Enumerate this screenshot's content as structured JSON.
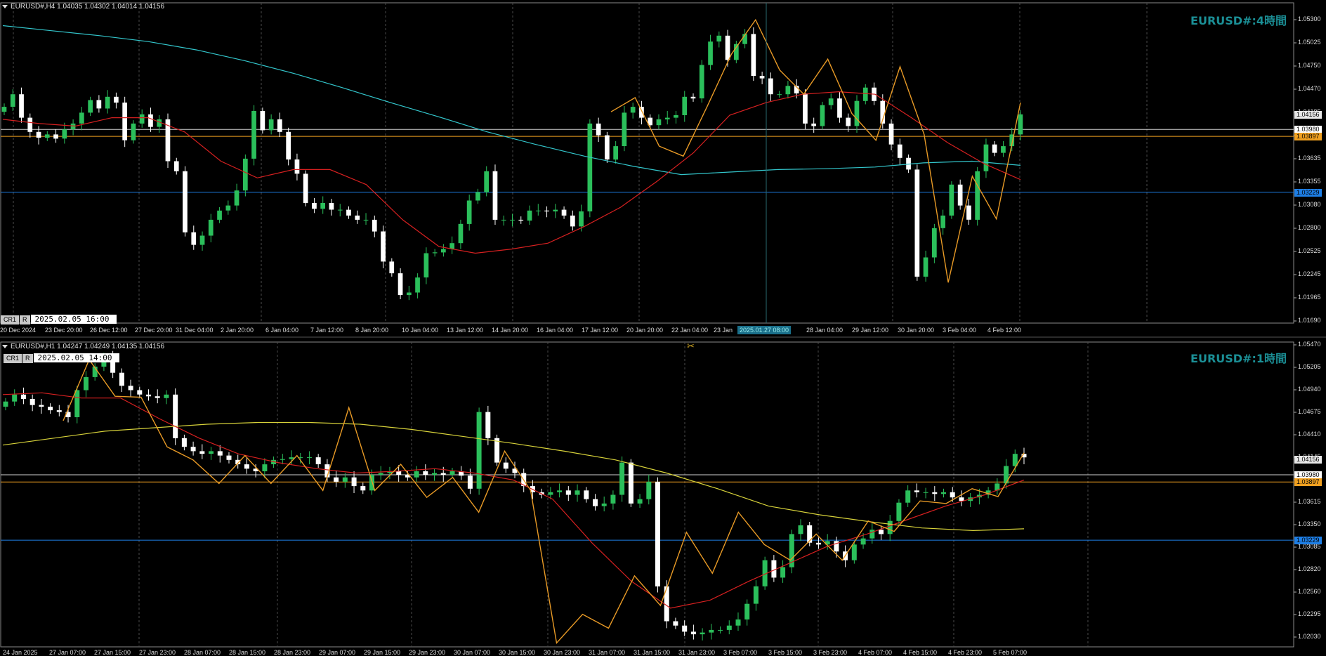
{
  "colors": {
    "bull": "#2bbf5b",
    "bear": "#ffffff",
    "ma_red": "#d62020",
    "ma_cyan": "#33c6cc",
    "ma_yellow": "#d7d23a",
    "zigzag": "#e89a26",
    "line_white": "#cfcfcf",
    "line_orange": "#f0a020",
    "line_blue": "#1e7fe6",
    "grid": "#4a4a4a",
    "watermark": "#1b8f96"
  },
  "h4": {
    "header": "EURUSD#,H4  1.04035 1.04302 1.04014 1.04156",
    "watermark": "EURUSD#:4時間",
    "cr": "CR1",
    "r": "R",
    "datetime": "2025.02.05 16:00",
    "price_ticks": [
      "1.05300",
      "1.05025",
      "1.04750",
      "1.04470",
      "1.04195",
      "1.03915",
      "1.03635",
      "1.03355",
      "1.03080",
      "1.02800",
      "1.02525",
      "1.02245",
      "1.01965",
      "1.01690"
    ],
    "time_ticks": [
      "20 Dec 2024",
      "23 Dec 20:00",
      "26 Dec 12:00",
      "27 Dec 20:00",
      "31 Dec 04:00",
      "2 Jan 20:00",
      "6 Jan 04:00",
      "7 Jan 12:00",
      "8 Jan 20:00",
      "10 Jan 04:00",
      "13 Jan 12:00",
      "14 Jan 20:00",
      "16 Jan 04:00",
      "17 Jan 12:00",
      "20 Jan 20:00",
      "22 Jan 04:00",
      "23 Jan",
      "28 Jan 04:00",
      "29 Jan 12:00",
      "30 Jan 20:00",
      "3 Feb 04:00",
      "4 Feb 12:00"
    ],
    "cursor_label": "2025.01.27 08:00",
    "level_tags": {
      "current": "1.04156",
      "white": "1.03980",
      "orange": "1.03897",
      "blue": "1.03229"
    },
    "closes": [
      1.0425,
      1.044,
      1.0412,
      1.0395,
      1.0388,
      1.0392,
      1.0387,
      1.0398,
      1.0405,
      1.0418,
      1.0433,
      1.0423,
      1.0437,
      1.043,
      1.0385,
      1.0405,
      1.0416,
      1.0401,
      1.041,
      1.036,
      1.0348,
      1.0275,
      1.026,
      1.0271,
      1.029,
      1.0301,
      1.0307,
      1.0325,
      1.0363,
      1.042,
      1.0397,
      1.041,
      1.0395,
      1.0362,
      1.0345,
      1.031,
      1.0303,
      1.031,
      1.0302,
      1.0302,
      1.0295,
      1.029,
      1.029,
      1.0276,
      1.024,
      1.0226,
      1.02,
      1.0203,
      1.0221,
      1.025,
      1.0251,
      1.0255,
      1.0262,
      1.0285,
      1.0313,
      1.0323,
      1.0348,
      1.029,
      1.029,
      1.029,
      1.0289,
      1.0301,
      1.0301,
      1.03,
      1.0302,
      1.0295,
      1.0282,
      1.03,
      1.0405,
      1.0391,
      1.0362,
      1.0378,
      1.0418,
      1.0425,
      1.0412,
      1.0403,
      1.041,
      1.0412,
      1.0415,
      1.0437,
      1.0435,
      1.0475,
      1.0503,
      1.051,
      1.0481,
      1.05,
      1.0512,
      1.0462,
      1.0459,
      1.044,
      1.044,
      1.045,
      1.0441,
      1.0405,
      1.0402,
      1.0427,
      1.0435,
      1.0412,
      1.0402,
      1.0432,
      1.0448,
      1.0432,
      1.0405,
      1.038,
      1.0364,
      1.035,
      1.0222,
      1.0245,
      1.028,
      1.0295,
      1.0332,
      1.0307,
      1.029,
      1.0348,
      1.038,
      1.037,
      1.0378,
      1.0392,
      1.0416
    ],
    "ma_cyan": [
      1.0522,
      1.0516,
      1.051,
      1.0503,
      1.0493,
      1.048,
      1.0465,
      1.0448,
      1.043,
      1.0413,
      1.0395,
      1.038,
      1.0366,
      1.0354,
      1.0344,
      1.0347,
      1.035,
      1.0351,
      1.0353,
      1.0358,
      1.036,
      1.0355
    ],
    "ma_red": [
      1.041,
      1.0405,
      1.0402,
      1.0412,
      1.0412,
      1.0395,
      1.036,
      1.034,
      1.035,
      1.035,
      1.0332,
      1.029,
      1.0258,
      1.025,
      1.0255,
      1.0262,
      1.0282,
      1.0305,
      1.0336,
      1.037,
      1.0415,
      1.043,
      1.044,
      1.0443,
      1.044,
      1.0412,
      1.0382,
      1.0357,
      1.0338
    ],
    "zigzag": [
      1.0419,
      1.0436,
      1.0378,
      1.0366,
      1.0426,
      1.0488,
      1.0529,
      1.0469,
      1.044,
      1.0482,
      1.0417,
      1.0385,
      1.0473,
      1.0392,
      1.0215,
      1.0342,
      1.0291,
      1.043
    ]
  },
  "h1": {
    "header": "EURUSD#,H1  1.04247 1.04249 1.04135 1.04156",
    "watermark": "EURUSD#:1時間",
    "cr": "CR1",
    "r": "R",
    "datetime": "2025.02.05 14:00",
    "price_ticks": [
      "1.05470",
      "1.05205",
      "1.04940",
      "1.04675",
      "1.04410",
      "1.04145",
      "1.03880",
      "1.03615",
      "1.03350",
      "1.03085",
      "1.02820",
      "1.02560",
      "1.02295",
      "1.02030"
    ],
    "time_ticks": [
      "24 Jan 2025",
      "27 Jan 07:00",
      "27 Jan 15:00",
      "27 Jan 23:00",
      "28 Jan 07:00",
      "28 Jan 15:00",
      "28 Jan 23:00",
      "29 Jan 07:00",
      "29 Jan 15:00",
      "29 Jan 23:00",
      "30 Jan 07:00",
      "30 Jan 15:00",
      "30 Jan 23:00",
      "31 Jan 07:00",
      "31 Jan 15:00",
      "31 Jan 23:00",
      "3 Feb 07:00",
      "3 Feb 15:00",
      "3 Feb 23:00",
      "4 Feb 07:00",
      "4 Feb 15:00",
      "4 Feb 23:00",
      "5 Feb 07:00"
    ],
    "level_tags": {
      "current": "1.04156",
      "white": "1.03980",
      "orange": "1.03897",
      "blue": "1.03229"
    },
    "closes": [
      1.0482,
      1.049,
      1.0485,
      1.0478,
      1.0476,
      1.0472,
      1.047,
      1.0464,
      1.0495,
      1.051,
      1.0522,
      1.0532,
      1.0515,
      1.05,
      1.0495,
      1.049,
      1.0488,
      1.0486,
      1.049,
      1.044,
      1.043,
      1.0425,
      1.0422,
      1.0425,
      1.042,
      1.0415,
      1.041,
      1.0405,
      1.0402,
      1.041,
      1.0415,
      1.0416,
      1.0418,
      1.0418,
      1.0418,
      1.041,
      1.0395,
      1.039,
      1.0395,
      1.0385,
      1.038,
      1.0398,
      1.04,
      1.0402,
      1.0398,
      1.0395,
      1.0402,
      1.0398,
      1.04,
      1.0398,
      1.0402,
      1.0397,
      1.0382,
      1.047,
      1.044,
      1.0412,
      1.0405,
      1.04,
      1.0385,
      1.0378,
      1.0375,
      1.0378,
      1.038,
      1.0375,
      1.038,
      1.037,
      1.0362,
      1.0365,
      1.0375,
      1.0412,
      1.0365,
      1.037,
      1.039,
      1.027,
      1.023,
      1.0225,
      1.0218,
      1.0215,
      1.0217,
      1.022,
      1.022,
      1.0225,
      1.0232,
      1.025,
      1.027,
      1.03,
      1.028,
      1.0292,
      1.033,
      1.034,
      1.032,
      1.0318,
      1.0322,
      1.031,
      1.03,
      1.0318,
      1.0325,
      1.0335,
      1.033,
      1.0345,
      1.0366,
      1.038,
      1.0378,
      1.0378,
      1.0376,
      1.0378,
      1.0372,
      1.0368,
      1.0372,
      1.0375,
      1.038,
      1.0388,
      1.0408,
      1.0422,
      1.0418
    ],
    "ma_yellow": [
      1.0432,
      1.044,
      1.0448,
      1.0452,
      1.0456,
      1.0458,
      1.0458,
      1.0456,
      1.045,
      1.0442,
      1.0434,
      1.0425,
      1.0415,
      1.04,
      1.0382,
      1.0362,
      1.0352,
      1.0344,
      1.0337,
      1.0334,
      1.0336
    ],
    "ma_red": [
      1.049,
      1.0492,
      1.0486,
      1.0486,
      1.0462,
      1.044,
      1.0422,
      1.0412,
      1.0405,
      1.04,
      1.0402,
      1.0405,
      1.04,
      1.0392,
      1.037,
      1.032,
      1.0276,
      1.0245,
      1.0254,
      1.0276,
      1.0296,
      1.0316,
      1.033,
      1.0346,
      1.0362,
      1.0375,
      1.0392
    ],
    "zigzag": [
      1.046,
      1.053,
      1.0488,
      1.0487,
      1.043,
      1.0415,
      1.0388,
      1.042,
      1.0388,
      1.042,
      1.038,
      1.0475,
      1.038,
      1.041,
      1.0372,
      1.0395,
      1.0355,
      1.0425,
      1.038,
      1.0205,
      1.0238,
      1.0222,
      1.0282,
      1.0248,
      1.0332,
      1.0285,
      1.0355,
      1.0318,
      1.03,
      1.033,
      1.03,
      1.0345,
      1.0333,
      1.0368,
      1.0365,
      1.0382,
      1.0373,
      1.0423
    ]
  }
}
